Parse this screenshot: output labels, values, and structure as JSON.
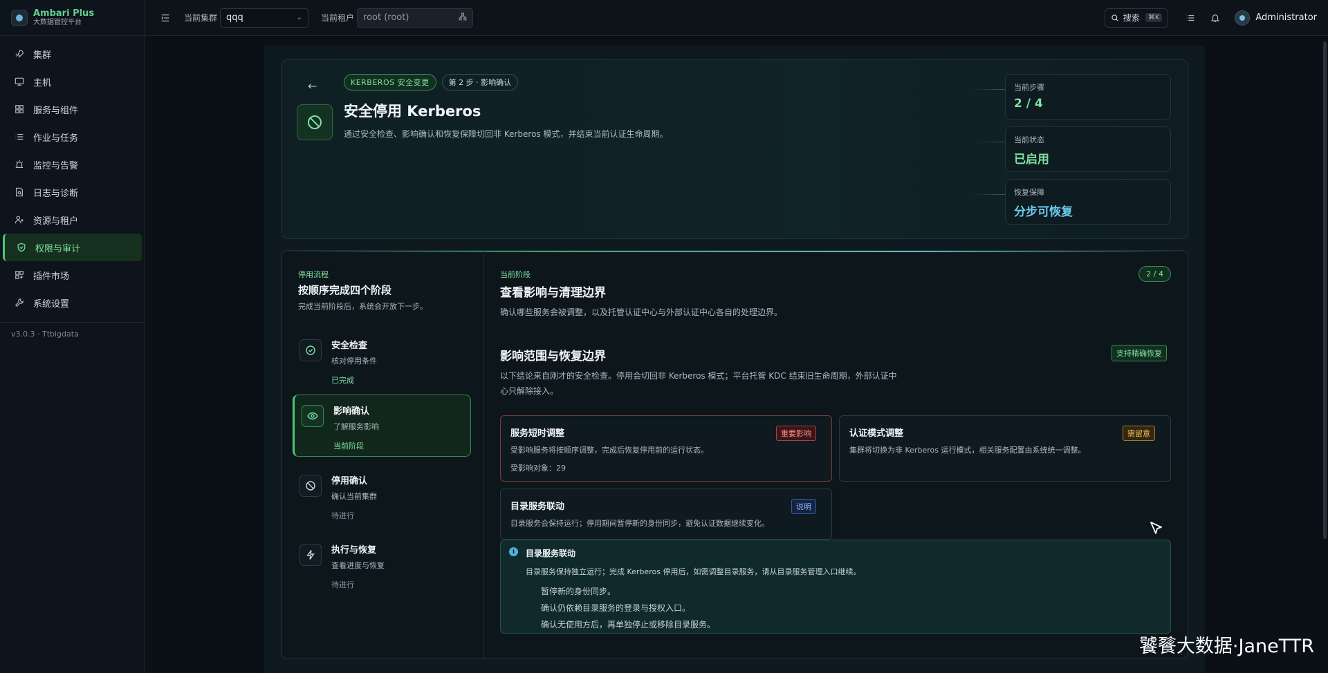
{
  "brand": {
    "name": "Ambari Plus",
    "subtitle": "大数据管控平台"
  },
  "sidebar": {
    "items": [
      {
        "label": "集群",
        "icon": "rocket-icon"
      },
      {
        "label": "主机",
        "icon": "monitor-icon"
      },
      {
        "label": "服务与组件",
        "icon": "grid-icon"
      },
      {
        "label": "作业与任务",
        "icon": "list-icon"
      },
      {
        "label": "监控与告警",
        "icon": "alarm-icon"
      },
      {
        "label": "日志与诊断",
        "icon": "document-search-icon"
      },
      {
        "label": "资源与租户",
        "icon": "users-icon"
      },
      {
        "label": "权限与审计",
        "icon": "shield-icon",
        "active": true
      },
      {
        "label": "插件市场",
        "icon": "puzzle-icon"
      },
      {
        "label": "系统设置",
        "icon": "wrench-icon"
      }
    ],
    "version": "v3.0.3 · Ttbigdata"
  },
  "topbar": {
    "cluster_label": "当前集群",
    "cluster_value": "qqq",
    "tenant_label": "当前租户",
    "tenant_value": "root (root)",
    "search_label": "搜索",
    "search_shortcut": "⌘K",
    "user_name": "Administrator"
  },
  "hero": {
    "tag_primary": "KERBEROS 安全变更",
    "tag_step": "第 2 步 · 影响确认",
    "title": "安全停用 Kerberos",
    "description": "通过安全检查、影响确认和恢复保障切回非 Kerberos 模式，并结束当前认证生命周期。",
    "stats": [
      {
        "label": "当前步骤",
        "value": "2 / 4",
        "color": "#7fe0a2"
      },
      {
        "label": "当前状态",
        "value": "已启用",
        "color": "#7fe0a2"
      },
      {
        "label": "恢复保障",
        "value": "分步可恢复",
        "color": "#6fc8ea"
      }
    ]
  },
  "steps_panel": {
    "kicker": "停用流程",
    "title": "按顺序完成四个阶段",
    "subtitle": "完成当前阶段后，系统会开放下一步。",
    "steps": [
      {
        "title": "安全检查",
        "desc": "核对停用条件",
        "status": "已完成",
        "status_color": "#7fe0a2",
        "icon": "check-circle-icon"
      },
      {
        "title": "影响确认",
        "desc": "了解服务影响",
        "status": "当前阶段",
        "status_color": "#7fe0a2",
        "icon": "eye-icon"
      },
      {
        "title": "停用确认",
        "desc": "确认当前集群",
        "status": "待进行",
        "status_color": "#8e99a4",
        "icon": "ban-icon"
      },
      {
        "title": "执行与恢复",
        "desc": "查看进度与恢复",
        "status": "待进行",
        "status_color": "#8e99a4",
        "icon": "lightning-icon"
      }
    ]
  },
  "phase": {
    "kicker": "当前阶段",
    "title": "查看影响与清理边界",
    "description": "确认哪些服务会被调整，以及托管认证中心与外部认证中心各自的处理边界。",
    "badge": "2 / 4"
  },
  "impact": {
    "title": "影响范围与恢复边界",
    "badge": "支持精确恢复",
    "description": "以下结论来自刚才的安全检查。停用会切回非 Kerberos 模式；平台托管 KDC 结束旧生命周期，外部认证中心只解除接入。",
    "cards": [
      {
        "title": "服务短时调整",
        "badge": "重要影响",
        "desc": "受影响服务将按顺序调整，完成后恢复停用前的运行状态。",
        "extra": "受影响对象：29"
      },
      {
        "title": "认证模式调整",
        "badge": "需留意",
        "desc": "集群将切换为非 Kerberos 运行模式，相关服务配置由系统统一调整。"
      },
      {
        "title": "目录服务联动",
        "badge": "说明",
        "desc": "目录服务会保持运行；停用期间暂停新的身份同步，避免认证数据继续变化。"
      }
    ],
    "info": {
      "title": "目录服务联动",
      "desc": "目录服务保持独立运行；完成 Kerberos 停用后，如需调整目录服务，请从目录服务管理入口继续。",
      "items": [
        "暂停新的身份同步。",
        "确认仍依赖目录服务的登录与授权入口。",
        "确认无使用方后，再单独停止或移除目录服务。"
      ]
    }
  },
  "watermark": "饕餮大数据·JaneTTR"
}
